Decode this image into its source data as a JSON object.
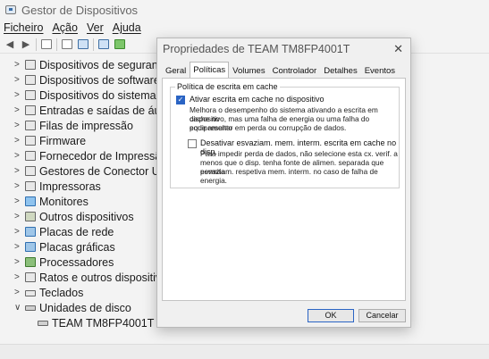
{
  "window": {
    "title": "Gestor de Dispositivos"
  },
  "menu": {
    "file": "Ficheiro",
    "action": "Ação",
    "view": "Ver",
    "help": "Ajuda"
  },
  "tree": {
    "items": [
      {
        "label": "Dispositivos de segurança",
        "expanded": false
      },
      {
        "label": "Dispositivos de software",
        "expanded": false
      },
      {
        "label": "Dispositivos do sistema",
        "expanded": false
      },
      {
        "label": "Entradas e saídas de áudio",
        "expanded": false
      },
      {
        "label": "Filas de impressão",
        "expanded": false
      },
      {
        "label": "Firmware",
        "expanded": false
      },
      {
        "label": "Fornecedor de Impressão V",
        "expanded": false
      },
      {
        "label": "Gestores de Conector USB",
        "expanded": false
      },
      {
        "label": "Impressoras",
        "expanded": false
      },
      {
        "label": "Monitores",
        "expanded": false
      },
      {
        "label": "Outros dispositivos",
        "expanded": false
      },
      {
        "label": "Placas de rede",
        "expanded": false
      },
      {
        "label": "Placas gráficas",
        "expanded": false
      },
      {
        "label": "Processadores",
        "expanded": false
      },
      {
        "label": "Ratos e outros dispositivos",
        "expanded": false
      },
      {
        "label": "Teclados",
        "expanded": false
      },
      {
        "label": "Unidades de disco",
        "expanded": true
      }
    ],
    "child": {
      "label": "TEAM TM8FP4001T"
    }
  },
  "dialog": {
    "title": "Propriedades de TEAM TM8FP4001T",
    "tabs": [
      "Geral",
      "Políticas",
      "Volumes",
      "Controlador",
      "Detalhes",
      "Eventos"
    ],
    "active_tab": "Políticas",
    "group_label": "Política de escrita em cache",
    "option1": {
      "label": "Ativar escrita em cache no dispositivo",
      "checked": true,
      "desc": [
        "Melhora o desempenho do sistema ativando a escrita em cache no",
        "dispositivo, mas uma falha de energia ou uma falha do equipamento",
        "pode resultar em perda ou corrupção de dados."
      ]
    },
    "option2": {
      "label": "Desativar esvaziam. mem. interm. escrita em cache no disp.",
      "checked": false,
      "desc": [
        "Para impedir perda de dados, não selecione esta cx. verif. a",
        "menos que o disp. tenha fonte de alimen. separada que permita",
        "esvaziam. respetiva mem. interm. no caso de falha de energia."
      ]
    },
    "ok_label": "OK",
    "cancel_label": "Cancelar",
    "close_glyph": "✕"
  }
}
